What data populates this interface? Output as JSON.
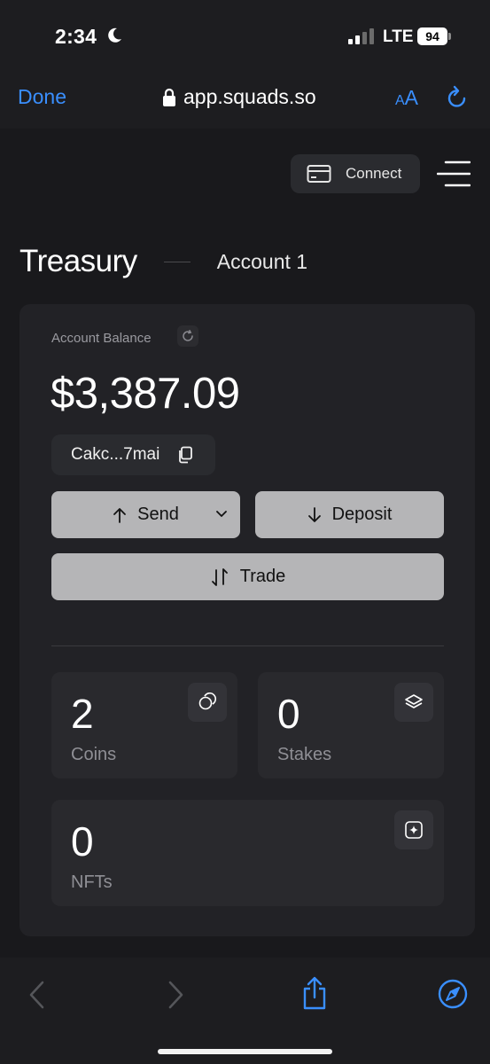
{
  "status_bar": {
    "time": "2:34",
    "network": "LTE",
    "battery": "94",
    "icons": [
      "moon-icon",
      "signal-icon",
      "battery-icon"
    ]
  },
  "browser": {
    "done_label": "Done",
    "url": "app.squads.so",
    "text_size_label_small": "A",
    "text_size_label_big": "A",
    "icons": [
      "lock-icon",
      "reload-icon"
    ]
  },
  "header": {
    "connect_label": "Connect",
    "icons": [
      "card-icon",
      "menu-icon"
    ]
  },
  "title": {
    "section": "Treasury",
    "account": "Account 1"
  },
  "balance_card": {
    "label": "Account Balance",
    "amount": "$3,387.09",
    "address": "Cakc...7mai",
    "actions": {
      "send": "Send",
      "deposit": "Deposit",
      "trade": "Trade"
    }
  },
  "stats": {
    "coins": {
      "value": "2",
      "label": "Coins"
    },
    "stakes": {
      "value": "0",
      "label": "Stakes"
    },
    "nfts": {
      "value": "0",
      "label": "NFTs"
    }
  },
  "toolbar": {
    "icons": [
      "back-icon",
      "forward-icon",
      "share-icon",
      "compass-icon"
    ]
  },
  "colors": {
    "accent_blue": "#3a8fff",
    "background": "#19191c",
    "card": "#222226",
    "button": "#b5b5b7"
  }
}
